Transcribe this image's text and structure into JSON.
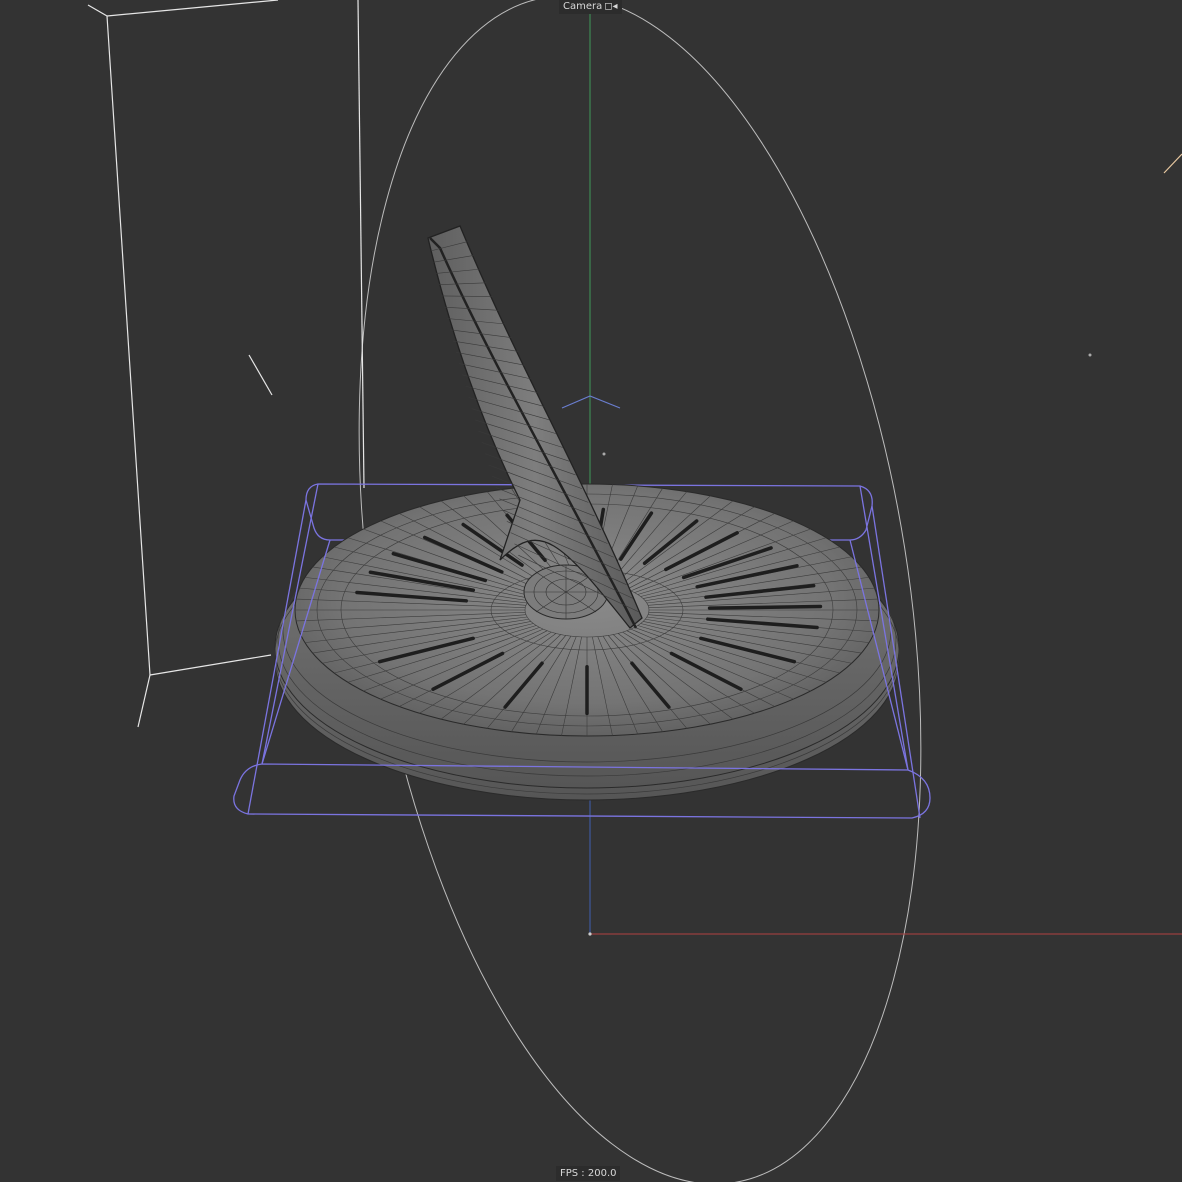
{
  "viewport": {
    "camera_label": "Camera",
    "camera_icon": "◻◂",
    "fps_label": "FPS : 200.0"
  },
  "colors": {
    "background": "#333333",
    "axis_x": "#b04040",
    "axis_y": "#3f9a5a",
    "axis_z": "#3f5fb0",
    "selection": "#7b74e0",
    "wire": "#d6d6d6",
    "mesh_fill": "#767676",
    "mesh_line": "#2a2a2a"
  },
  "scene": {
    "object_icon": "sundial-mesh-icon",
    "light_icon": "spot-light-icon",
    "camera_icon": "camera-frustum-icon"
  }
}
